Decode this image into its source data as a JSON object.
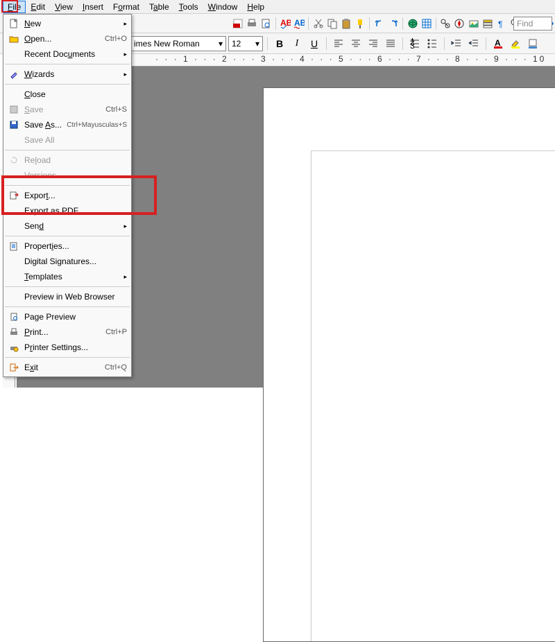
{
  "menubar": {
    "items": [
      "File",
      "Edit",
      "View",
      "Insert",
      "Format",
      "Table",
      "Tools",
      "Window",
      "Help"
    ]
  },
  "toolbar2": {
    "font_name": "imes New Roman",
    "font_size": "12"
  },
  "find": {
    "placeholder": "Find"
  },
  "ruler": {
    "text": "· · · 1 · · · 2 · · · 3 · · · 4 · · · 5 · · · 6 · · · 7 · · · 8 · · · 9 · · · 10"
  },
  "file_menu": {
    "new": "New",
    "open": "Open...",
    "open_accel": "Ctrl+O",
    "recent": "Recent Documents",
    "wizards": "Wizards",
    "close": "Close",
    "save": "Save",
    "save_accel": "Ctrl+S",
    "save_as": "Save As...",
    "save_as_accel": "Ctrl+Mayusculas+S",
    "save_all": "Save All",
    "reload": "Reload",
    "versions": "Versions...",
    "export": "Export...",
    "export_pdf": "Export as PDF...",
    "send": "Send",
    "properties": "Properties...",
    "signatures": "Digital Signatures...",
    "templates": "Templates",
    "preview_web": "Preview in Web Browser",
    "page_preview": "Page Preview",
    "print": "Print...",
    "print_accel": "Ctrl+P",
    "printer_settings": "Printer Settings...",
    "exit": "Exit",
    "exit_accel": "Ctrl+Q"
  }
}
